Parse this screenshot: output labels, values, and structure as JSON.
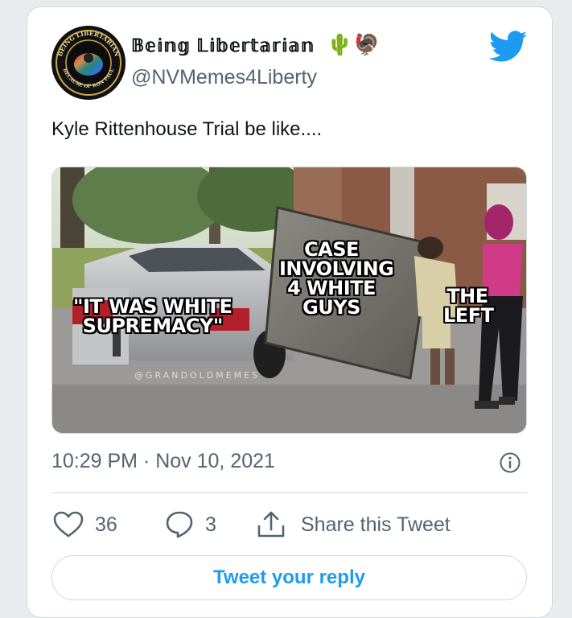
{
  "tweet": {
    "display_name": "𝔹𝕖𝕚𝕟𝕘 𝕃𝕚𝕓𝕖𝕣𝕥𝕒𝕣𝕚𝕒𝕟",
    "display_name_emojis": "🌵🦃",
    "handle": "@NVMemes4Liberty",
    "text": "Kyle Rittenhouse Trial be like....",
    "timestamp": "10:29 PM · Nov 10, 2021",
    "like_count": "36",
    "reply_count": "3",
    "share_label": "Share this Tweet",
    "reply_placeholder": "Tweet your reply"
  },
  "avatar": {
    "ring_text_top": "BEING LIBERTARIAN",
    "ring_text_bottom": "BECAUSE OF RON PAUL"
  },
  "meme": {
    "car_label_line1": "\"IT WAS WHITE",
    "car_label_line2": "SUPREMACY\"",
    "mattress_label_line1": "CASE",
    "mattress_label_line2": "INVOLVING",
    "mattress_label_line3": "4 WHITE",
    "mattress_label_line4": "GUYS",
    "woman_label_line1": "THE",
    "woman_label_line2": "LEFT",
    "watermark": "@GRANDOLDMEMES"
  },
  "colors": {
    "twitter_blue": "#1d9bf0",
    "text_primary": "#0f1419",
    "text_secondary": "#536471",
    "border": "#cfd9de"
  },
  "icons": {
    "like": "heart-icon",
    "reply": "speech-bubble-icon",
    "share": "share-upload-icon",
    "info": "info-icon",
    "brand": "twitter-bird-icon"
  }
}
